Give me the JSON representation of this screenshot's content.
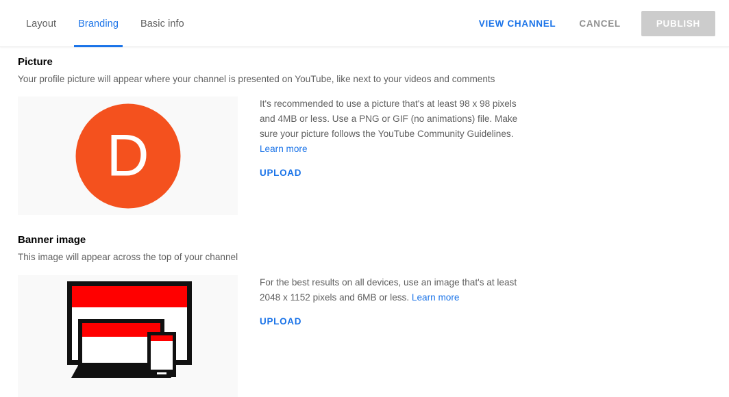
{
  "header": {
    "tabs": [
      {
        "label": "Layout",
        "active": false
      },
      {
        "label": "Branding",
        "active": true
      },
      {
        "label": "Basic info",
        "active": false
      }
    ],
    "actions": {
      "view_channel": "VIEW CHANNEL",
      "cancel": "CANCEL",
      "publish": "PUBLISH",
      "publish_enabled": false
    }
  },
  "colors": {
    "accent_blue": "#1a73e8",
    "avatar_orange": "#f4511e",
    "banner_red": "#ff0000",
    "device_black": "#111111",
    "publish_disabled_bg": "#cccccc",
    "placeholder_bg": "#f9f9f9"
  },
  "picture": {
    "title": "Picture",
    "description": "Your profile picture will appear where your channel is presented on YouTube, like next to your videos and comments",
    "avatar_letter": "D",
    "info_text": "It's recommended to use a picture that's at least 98 x 98 pixels and 4MB or less. Use a PNG or GIF (no animations) file. Make sure your picture follows the YouTube Community Guidelines.",
    "learn_more": "Learn more",
    "upload_label": "UPLOAD"
  },
  "banner": {
    "title": "Banner image",
    "description": "This image will appear across the top of your channel",
    "info_text": "For the best results on all devices, use an image that's at least 2048 x 1152 pixels and 6MB or less.",
    "learn_more": "Learn more",
    "upload_label": "UPLOAD"
  }
}
